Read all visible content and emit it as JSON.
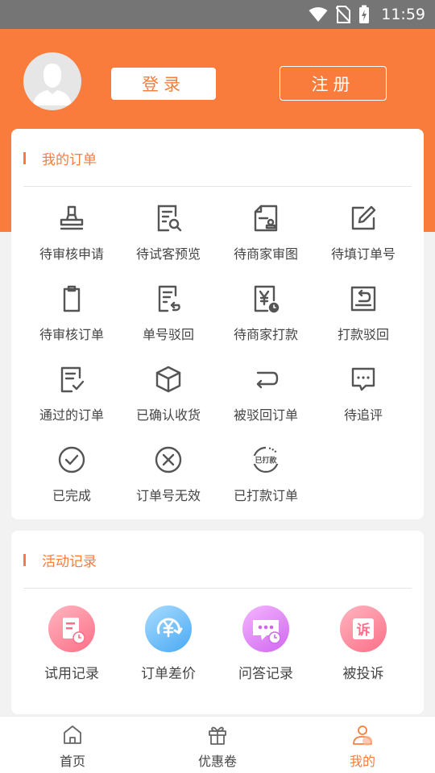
{
  "status_bar": {
    "time": "11:59"
  },
  "header": {
    "login_label": "登录",
    "register_label": "注册"
  },
  "orders": {
    "title": "我的订单",
    "items": [
      {
        "label": "待审核申请",
        "icon": "stamp-icon"
      },
      {
        "label": "待试客预览",
        "icon": "document-search-icon"
      },
      {
        "label": "待商家审图",
        "icon": "image-review-icon"
      },
      {
        "label": "待填订单号",
        "icon": "edit-icon"
      },
      {
        "label": "待审核订单",
        "icon": "clipboard-icon"
      },
      {
        "label": "单号驳回",
        "icon": "document-return-icon"
      },
      {
        "label": "待商家打款",
        "icon": "yen-clock-icon"
      },
      {
        "label": "打款驳回",
        "icon": "return-box-icon"
      },
      {
        "label": "通过的订单",
        "icon": "document-check-icon"
      },
      {
        "label": "已确认收货",
        "icon": "package-icon"
      },
      {
        "label": "被驳回订单",
        "icon": "return-arrow-icon"
      },
      {
        "label": "待追评",
        "icon": "chat-bubble-icon"
      },
      {
        "label": "已完成",
        "icon": "check-circle-icon"
      },
      {
        "label": "订单号无效",
        "icon": "x-circle-icon"
      },
      {
        "label": "已打款订单",
        "icon": "paid-stamp-icon"
      }
    ],
    "paid_stamp_text": "已打款"
  },
  "activity": {
    "title": "活动记录",
    "items": [
      {
        "label": "试用记录",
        "icon": "trial-record-icon"
      },
      {
        "label": "订单差价",
        "icon": "yen-refresh-icon"
      },
      {
        "label": "问答记录",
        "icon": "qa-chat-icon"
      },
      {
        "label": "被投诉",
        "icon": "complaint-icon"
      }
    ],
    "complaint_glyph": "诉"
  },
  "tabbar": {
    "items": [
      {
        "label": "首页",
        "icon": "home-icon"
      },
      {
        "label": "优惠卷",
        "icon": "gift-icon"
      },
      {
        "label": "我的",
        "icon": "profile-icon"
      }
    ],
    "active_index": 2
  },
  "colors": {
    "accent": "#f97c3c",
    "status_bar": "#757575",
    "icon_gray": "#555555"
  }
}
